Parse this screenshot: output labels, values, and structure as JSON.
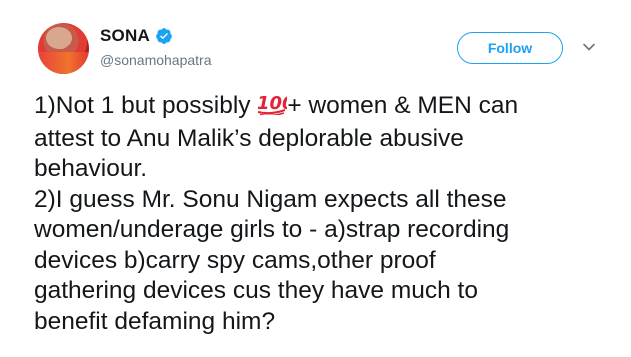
{
  "tweet": {
    "author": {
      "display_name": "SONA",
      "handle": "@sonamohapatra",
      "verified": true,
      "avatar_icon": "profile-avatar"
    },
    "follow_label": "Follow",
    "menu_icon": "chevron-down-icon",
    "accent_color": "#1da1f2",
    "text": {
      "line1_before": "1)Not 1 but possibly ",
      "emoji": "💯",
      "line1_after": "+ women & MEN can",
      "line2": "attest to Anu Malik’s deplorable abusive",
      "line3": "behaviour.",
      "line4": "2)I guess Mr. Sonu Nigam expects all these",
      "line5": "women/underage girls to - a)strap recording",
      "line6": "devices b)carry spy cams,other proof",
      "line7": "gathering devices cus they have much to",
      "line8": "benefit defaming him?"
    }
  }
}
